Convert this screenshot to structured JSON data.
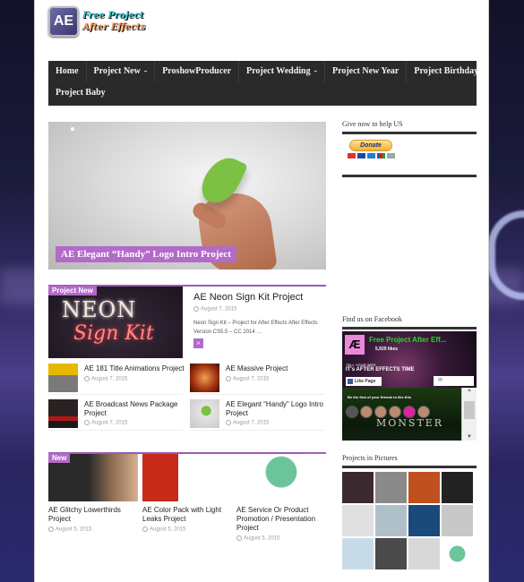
{
  "site": {
    "logo_badge": "AE",
    "logo_line1": "Free Project",
    "logo_line2": "After Effects"
  },
  "nav": {
    "items": [
      {
        "label": "Home",
        "has_dropdown": false
      },
      {
        "label": "Project New",
        "has_dropdown": true
      },
      {
        "label": "ProshowProducer",
        "has_dropdown": false
      },
      {
        "label": "Project Wedding",
        "has_dropdown": true
      },
      {
        "label": "Project New Year",
        "has_dropdown": false
      },
      {
        "label": "Project Birthday",
        "has_dropdown": false
      },
      {
        "label": "Project Baby",
        "has_dropdown": false
      }
    ],
    "dropdown_glyph": "-"
  },
  "slider": {
    "caption": "AE Elegant “Handy” Logo Intro Project",
    "pagination_dots": 1
  },
  "project_new": {
    "label": "Project New",
    "featured": {
      "image_text_1": "NEON",
      "image_text_2": "Sign Kit",
      "title": "AE Neon Sign Kit Project",
      "date": "August 7, 2015",
      "excerpt": "Neon Sign Kit – Project for After Effects After Effects Version CS5.5 – CC 2014 …",
      "more_glyph": "»"
    },
    "items": [
      {
        "title": "AE 181 Title Animations Project",
        "date": "August 7, 2015",
        "thumb_color": "#7a7a7a"
      },
      {
        "title": "AE Massive Project",
        "date": "August 7, 2015",
        "thumb_color": "#c0501a"
      },
      {
        "title": "AE Broadcast News Package Project",
        "date": "August 7, 2015",
        "thumb_color": "#2a1a1a"
      },
      {
        "title": "AE Elegant “Handy” Logo Intro Project",
        "date": "August 7, 2015",
        "thumb_color": "#d8d8d8"
      }
    ]
  },
  "new_carousel": {
    "label": "New",
    "prev_glyph": "‹",
    "next_glyph": "›",
    "items": [
      {
        "title": "AE Glitchy Lowerthirds Project",
        "date": "August 5, 2015"
      },
      {
        "title": "AE Color Pack with Light Leaks Project",
        "date": "August 5, 2015"
      },
      {
        "title": "AE Service Or Product Promotion / Presentation Project",
        "date": "August 5, 2015"
      }
    ]
  },
  "sidebar": {
    "donate": {
      "title": "Give now to help US",
      "button_label": "Donate"
    },
    "facebook": {
      "title": "Find us on Facebook",
      "page_name": "Free Project After Eff...",
      "likes": "5,929 likes",
      "tagline_small": "TELL YOUR WIFE",
      "tagline": "IT's AFTER EFFECTS TIME",
      "like_button": "Like Page",
      "friends_text": "Be the first of your friends to like this",
      "banner_text": "MONSTER"
    },
    "pictures": {
      "title": "Projects in Pictures",
      "tiles": [
        "#3a2a30",
        "#8a8a8a",
        "#c05020",
        "#222222",
        "#e0e0e0",
        "#b0c0c8",
        "#1a4a7a",
        "#c8c8c8",
        "#c8dce8",
        "#4a4a4a",
        "#d8d8d8",
        "#ffffff"
      ]
    }
  }
}
